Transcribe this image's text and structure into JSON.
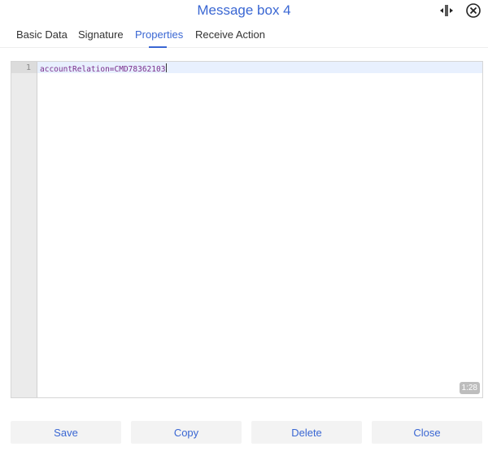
{
  "header": {
    "title": "Message box 4",
    "resize_icon": "split-resize-icon",
    "close_icon": "close-circle-icon"
  },
  "tabs": [
    {
      "label": "Basic Data",
      "active": false
    },
    {
      "label": "Signature",
      "active": false
    },
    {
      "label": "Properties",
      "active": true
    },
    {
      "label": "Receive Action",
      "active": false
    }
  ],
  "editor": {
    "lines": [
      {
        "number": "1",
        "text": "accountRelation=CMD78362103"
      }
    ],
    "cursor_position": "1:28"
  },
  "footer": {
    "save_label": "Save",
    "copy_label": "Copy",
    "delete_label": "Delete",
    "close_label": "Close"
  },
  "colors": {
    "accent": "#3a67d3",
    "code_text": "#7a2e8c"
  }
}
